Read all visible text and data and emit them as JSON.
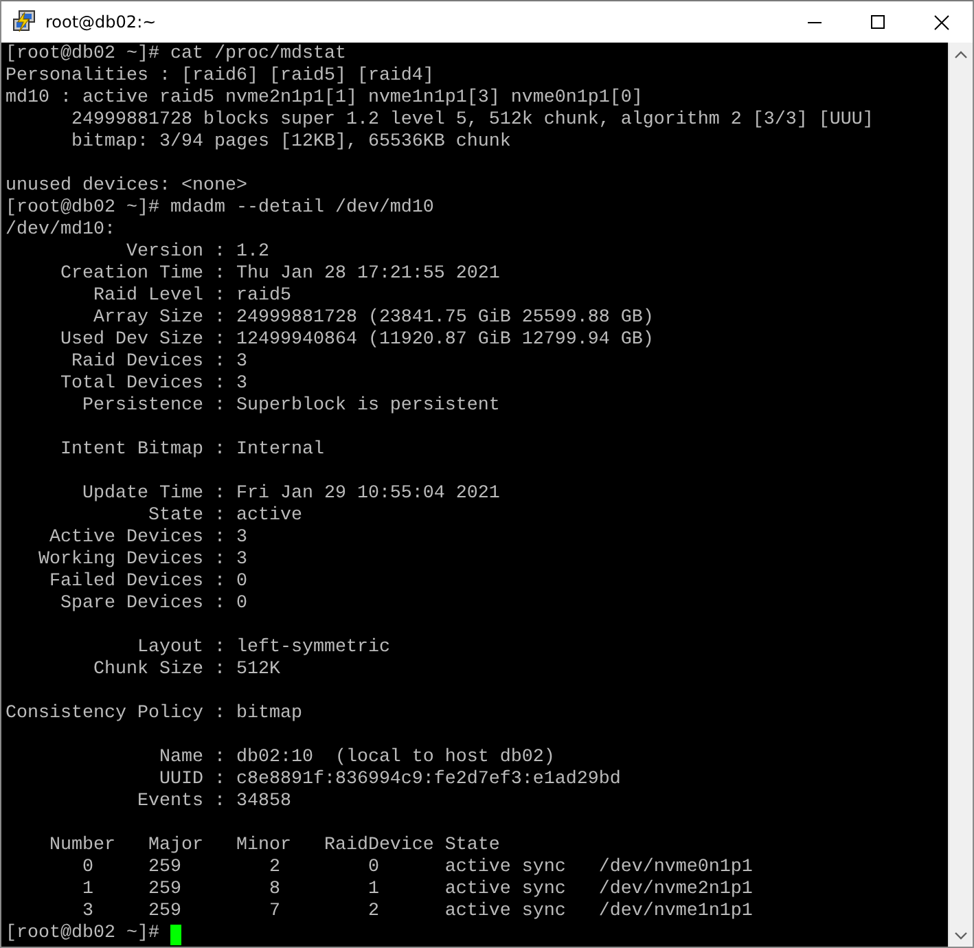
{
  "window": {
    "title": "root@db02:~"
  },
  "terminal": {
    "blocks": [
      {
        "lines": [
          {
            "text": "[root@db02 ~]# cat /proc/mdstat"
          },
          {
            "text": "Personalities : [raid6] [raid5] [raid4]"
          },
          {
            "text": "md10 : active raid5 nvme2n1p1[1] nvme1n1p1[3] nvme0n1p1[0]"
          },
          {
            "text": "      24999881728 blocks super 1.2 level 5, 512k chunk, algorithm 2 [3/3] [UUU]"
          },
          {
            "text": "      bitmap: 3/94 pages [12KB], 65536KB chunk"
          }
        ]
      },
      {
        "lines": [
          {
            "text": "unused devices: <none>"
          },
          {
            "text": "[root@db02 ~]# mdadm --detail /dev/md10"
          },
          {
            "text": "/dev/md10:"
          },
          {
            "text": "           Version : 1.2"
          },
          {
            "text": "     Creation Time : Thu Jan 28 17:21:55 2021"
          },
          {
            "text": "        Raid Level : raid5"
          },
          {
            "text": "        Array Size : 24999881728 (23841.75 GiB 25599.88 GB)"
          },
          {
            "text": "     Used Dev Size : 12499940864 (11920.87 GiB 12799.94 GB)"
          },
          {
            "text": "      Raid Devices : 3"
          },
          {
            "text": "     Total Devices : 3"
          },
          {
            "text": "       Persistence : Superblock is persistent"
          }
        ]
      },
      {
        "lines": [
          {
            "text": "     Intent Bitmap : Internal"
          }
        ]
      },
      {
        "lines": [
          {
            "text": "       Update Time : Fri Jan 29 10:55:04 2021"
          },
          {
            "text": "             State : active"
          },
          {
            "text": "    Active Devices : 3"
          },
          {
            "text": "   Working Devices : 3"
          },
          {
            "text": "    Failed Devices : 0"
          },
          {
            "text": "     Spare Devices : 0"
          }
        ]
      },
      {
        "lines": [
          {
            "text": "            Layout : left-symmetric"
          },
          {
            "text": "        Chunk Size : 512K"
          }
        ]
      },
      {
        "lines": [
          {
            "text": "Consistency Policy : bitmap"
          }
        ]
      },
      {
        "lines": [
          {
            "text": "              Name : db02:10  (local to host db02)"
          },
          {
            "text": "              UUID : c8e8891f:836994c9:fe2d7ef3:e1ad29bd"
          },
          {
            "text": "            Events : 34858"
          }
        ]
      },
      {
        "lines": [
          {
            "text": "    Number   Major   Minor   RaidDevice State"
          },
          {
            "text": "       0     259        2        0      active sync   /dev/nvme0n1p1"
          },
          {
            "text": "       1     259        8        1      active sync   /dev/nvme2n1p1"
          },
          {
            "text": "       3     259        7        2      active sync   /dev/nvme1n1p1"
          },
          {
            "text": "[root@db02 ~]# ",
            "cursor": true
          }
        ]
      }
    ]
  }
}
